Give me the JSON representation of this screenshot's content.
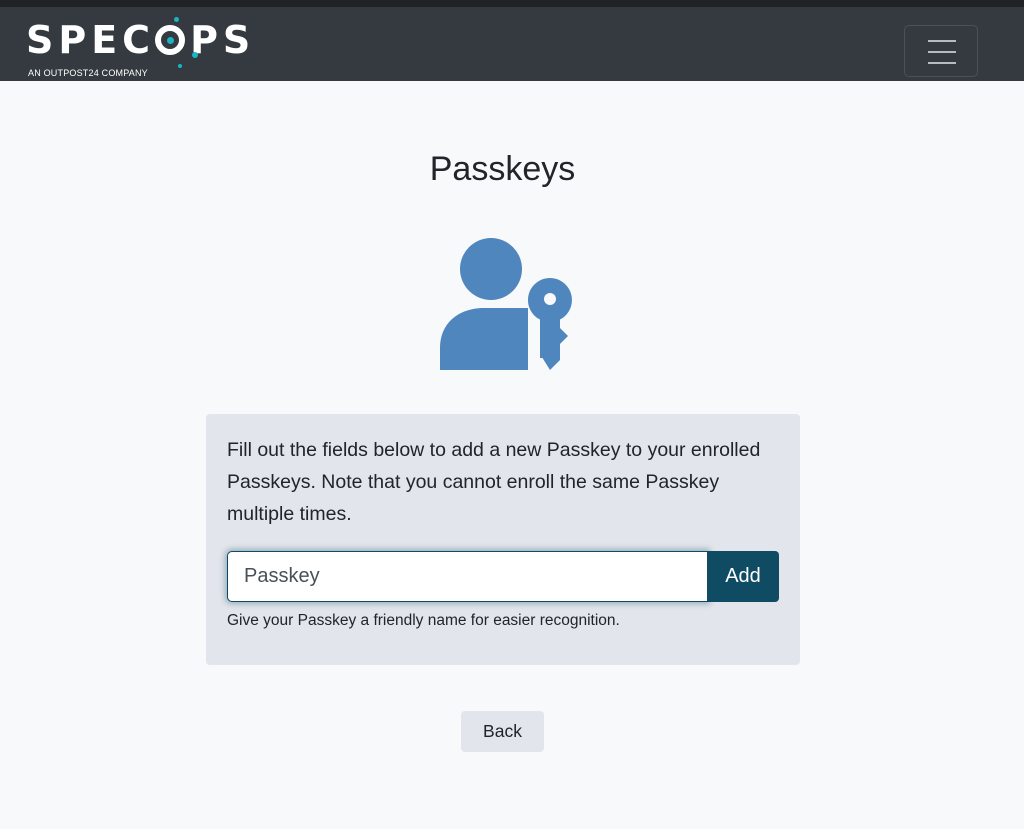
{
  "brand": {
    "name_prefix": "SPEC",
    "name_suffix": "PS",
    "tagline": "AN OUTPOST24 COMPANY",
    "accent_color": "#19b5c2",
    "logo_name": "specops-logo"
  },
  "navbar": {
    "menu_icon": "hamburger-menu-icon",
    "background": "#343a40"
  },
  "page": {
    "title": "Passkeys",
    "icon": "user-key-icon",
    "icon_color": "#4f86be"
  },
  "form": {
    "description": "Fill out the fields below to add a new Passkey to your enrolled Passkeys. Note that you cannot enroll the same Passkey multiple times.",
    "name_value": "Passkey",
    "add_label": "Add",
    "helper_text": "Give your Passkey a friendly name for easier recognition.",
    "button_color": "#0f4c63"
  },
  "footer": {
    "back_label": "Back"
  }
}
